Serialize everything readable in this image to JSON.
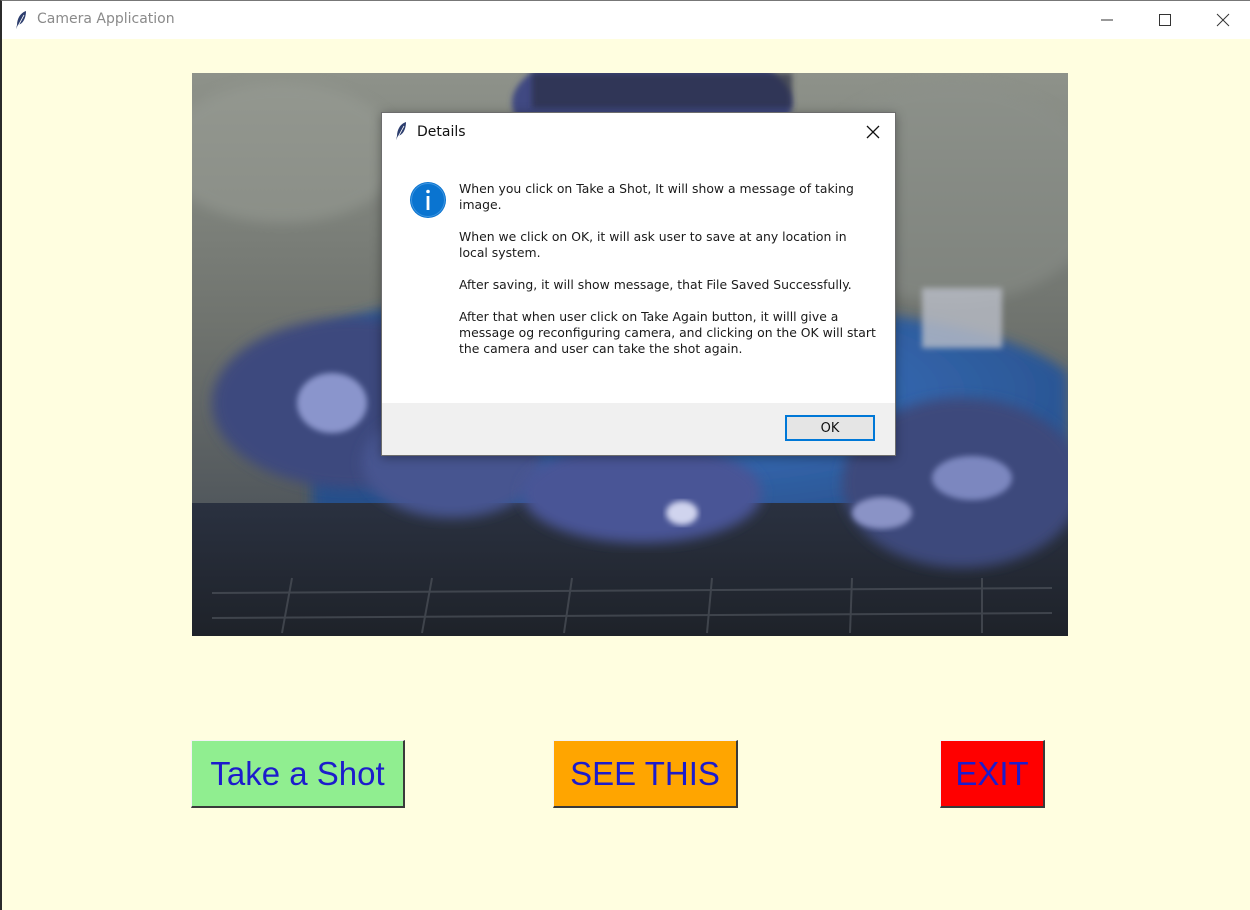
{
  "window": {
    "title": "Camera Application"
  },
  "buttons": {
    "take_shot": "Take a Shot",
    "see_this": "SEE THIS",
    "exit": "EXIT"
  },
  "dialog": {
    "title": "Details",
    "messages": [
      "When you click on Take a Shot, It will show a message of taking image.",
      "When we click on OK, it will ask user to save at any location in local system.",
      "After saving, it will show message, that File Saved Successfully.",
      "After that when user click on Take Again button, it willl give a message og reconfiguring camera, and clicking on the OK will start the camera and user can take the shot again."
    ],
    "ok_label": "OK"
  },
  "colors": {
    "background": "#fffee0",
    "take_shot_bg": "#90ee90",
    "see_this_bg": "#ffa500",
    "exit_bg": "#ff0000",
    "button_text": "#1c1ccc",
    "info_blue": "#0a74d0"
  },
  "icons": [
    "feather-icon",
    "minimize-icon",
    "maximize-icon",
    "close-icon",
    "info-icon"
  ]
}
